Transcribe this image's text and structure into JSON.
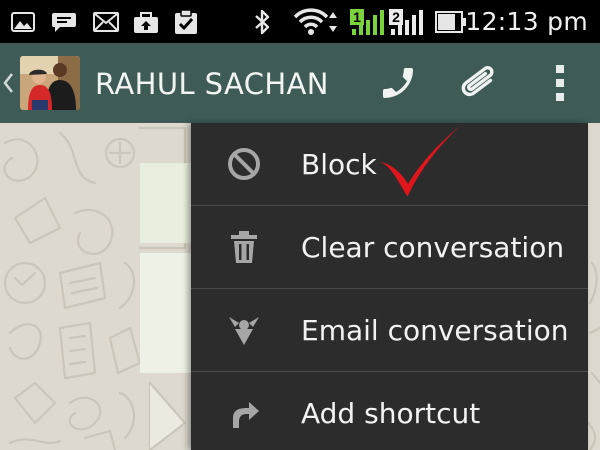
{
  "status_bar": {
    "time": "12:13 pm",
    "icons": [
      "image-icon",
      "chat-bubble-icon",
      "mail-icon",
      "briefcase-upload-icon",
      "clipboard-check-icon",
      "bluetooth-icon",
      "wifi-icon",
      "signal-sim1-icon",
      "signal-sim2-icon",
      "battery-icon"
    ],
    "sim1_label": "1",
    "sim2_label": "2"
  },
  "action_bar": {
    "contact_name": "RAHUL SACHAN",
    "icons": [
      "back-chevron-icon",
      "avatar",
      "phone-icon",
      "attach-icon",
      "overflow-menu-icon"
    ],
    "colors": {
      "background": "#3e5b57",
      "text": "#f3f5f4"
    }
  },
  "menu": {
    "items": [
      {
        "label": "Block",
        "icon": "block-icon"
      },
      {
        "label": "Clear conversation",
        "icon": "trash-icon"
      },
      {
        "label": "Email conversation",
        "icon": "email-conversation-icon"
      },
      {
        "label": "Add shortcut",
        "icon": "shortcut-arrow-icon"
      }
    ],
    "colors": {
      "background": "#2c2c2c",
      "text": "#f2f2f2",
      "divider": "#4a4a4a"
    }
  },
  "annotation": {
    "icon": "red-checkmark-icon",
    "color": "#e0161c"
  },
  "colors": {
    "status_bar": "#000000",
    "chat_background": "#ddd9cf",
    "signal_green": "#7ad23c"
  }
}
